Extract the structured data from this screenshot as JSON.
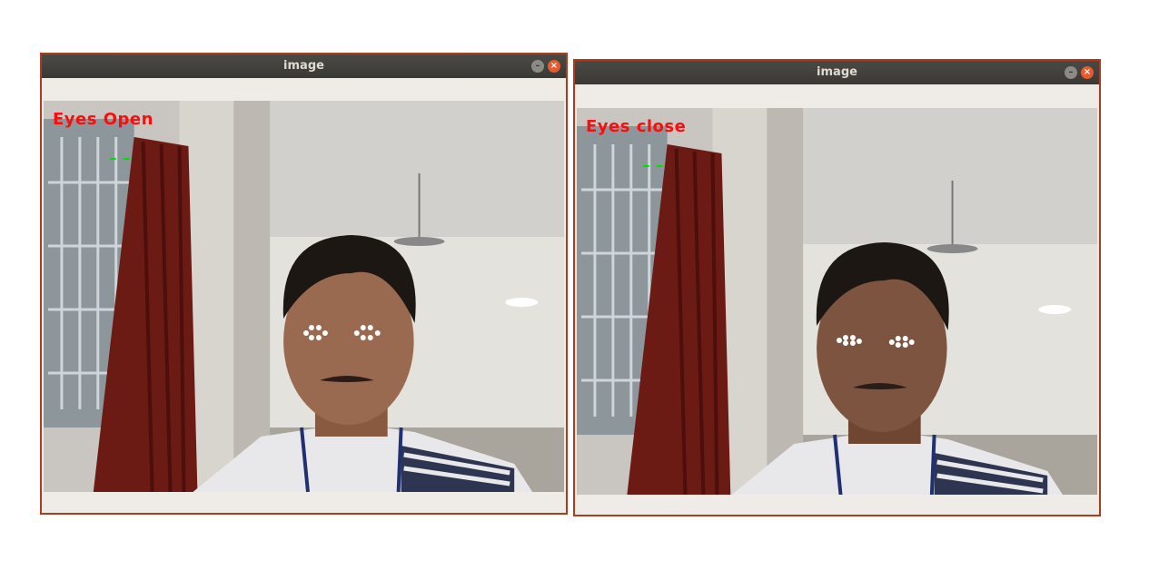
{
  "windows": [
    {
      "title": "image",
      "min_glyph": "–",
      "close_glyph": "×",
      "status_label": "Eyes Open",
      "label_color": "#ff0b0b"
    },
    {
      "title": "image",
      "min_glyph": "–",
      "close_glyph": "×",
      "status_label": "Eyes close",
      "label_color": "#ff0b0b"
    }
  ],
  "colors": {
    "window_border": "#b23a1c",
    "titlebar": "#3f3e3a",
    "close_button": "#e65a2e",
    "landmark_points": "#ffffff",
    "contour_lines": "#00e000"
  }
}
